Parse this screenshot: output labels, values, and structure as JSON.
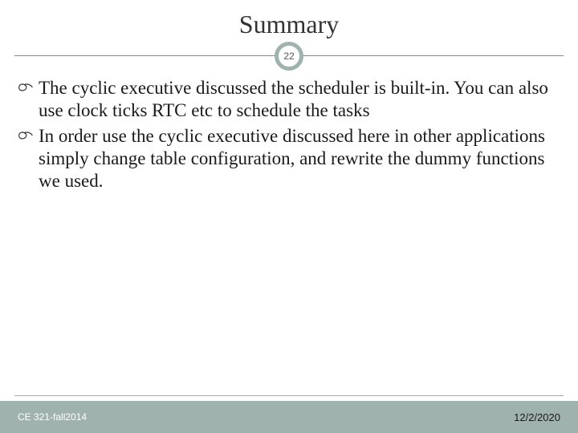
{
  "title": "Summary",
  "slide_number": "22",
  "bullets": [
    "The cyclic executive discussed the scheduler is built-in. You can also use clock ticks RTC etc to schedule the tasks",
    "In order use the cyclic executive discussed here in other applications simply change table configuration, and rewrite the dummy functions we used."
  ],
  "footer": {
    "left": "CE 321-fall2014",
    "right": "12/2/2020"
  },
  "colors": {
    "accent": "#9fb2ad",
    "text": "#1a1a1a"
  }
}
